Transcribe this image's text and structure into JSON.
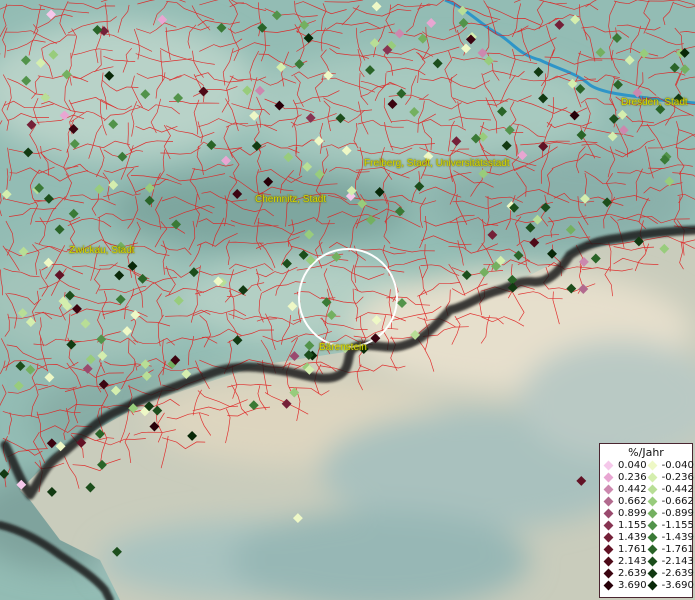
{
  "map": {
    "cities": [
      {
        "name": "Dresden, Stadt",
        "color": "#d8d800"
      },
      {
        "name": "Freiberg, Stadt, Universitätsstadt",
        "color": "#d8d800"
      },
      {
        "name": "Chemnitz, Stadt",
        "color": "#d8d800"
      },
      {
        "name": "Zwickau, Stadt",
        "color": "#d8d800"
      },
      {
        "name": "Bärenstein",
        "color": "#d8d800"
      }
    ],
    "colors": {
      "border": "#e02020",
      "country_border": "#111111",
      "river": "#2e95c8",
      "terrain_low": "#8fb8b2",
      "terrain_high": "#d8d4c0"
    }
  },
  "legend": {
    "title": "%/Jahr",
    "positive": [
      {
        "label": "0.040",
        "color": "#f5c8ea"
      },
      {
        "label": "0.236",
        "color": "#e8a6d2"
      },
      {
        "label": "0.442",
        "color": "#cc88ae"
      },
      {
        "label": "0.662",
        "color": "#b26a8e"
      },
      {
        "label": "0.899",
        "color": "#9a4a6e"
      },
      {
        "label": "1.155",
        "color": "#873452"
      },
      {
        "label": "1.439",
        "color": "#742038"
      },
      {
        "label": "1.761",
        "color": "#621225"
      },
      {
        "label": "2.143",
        "color": "#4e0a18"
      },
      {
        "label": "2.639",
        "color": "#3b0410"
      },
      {
        "label": "3.690",
        "color": "#270008"
      }
    ],
    "negative": [
      {
        "label": "-0.040",
        "color": "#eef8c6"
      },
      {
        "label": "-0.236",
        "color": "#d4eeae"
      },
      {
        "label": "-0.442",
        "color": "#b8de96"
      },
      {
        "label": "-0.662",
        "color": "#98cc7c"
      },
      {
        "label": "-0.899",
        "color": "#74b060"
      },
      {
        "label": "-1.155",
        "color": "#52934a"
      },
      {
        "label": "-1.439",
        "color": "#3a7a36"
      },
      {
        "label": "-1.761",
        "color": "#2a6428"
      },
      {
        "label": "-2.143",
        "color": "#1c4e1c"
      },
      {
        "label": "-2.639",
        "color": "#123a12"
      },
      {
        "label": "-3.690",
        "color": "#082808"
      }
    ]
  }
}
